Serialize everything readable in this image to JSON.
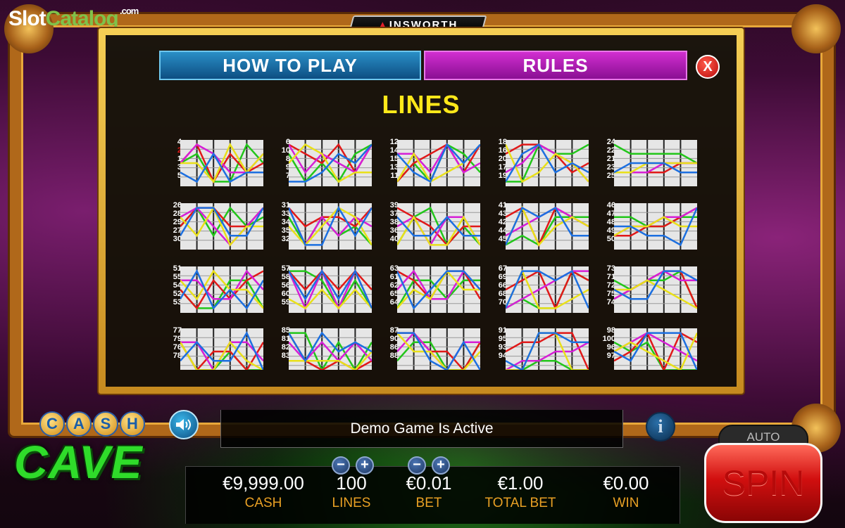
{
  "watermark": {
    "slot": "Slot",
    "catalog": "Catalog",
    "com": ".com"
  },
  "provider": {
    "name": "INSWORTH",
    "triangle": "▲"
  },
  "tabs": {
    "how_to_play": "HOW TO PLAY",
    "rules": "RULES"
  },
  "close_label": "X",
  "lines_title": "LINES",
  "paylines": [
    {
      "nums": [
        "4",
        "2",
        "1",
        "3",
        "5"
      ]
    },
    {
      "nums": [
        "6",
        "10",
        "8",
        "9",
        "7"
      ]
    },
    {
      "nums": [
        "12",
        "14",
        "15",
        "13",
        "11"
      ]
    },
    {
      "nums": [
        "18",
        "16",
        "20",
        "17",
        "19"
      ]
    },
    {
      "nums": [
        "24",
        "22",
        "21",
        "23",
        "25"
      ]
    },
    {
      "nums": [
        "26",
        "28",
        "29",
        "27",
        "30"
      ]
    },
    {
      "nums": [
        "31",
        "33",
        "34",
        "35",
        "32"
      ]
    },
    {
      "nums": [
        "39",
        "37",
        "38",
        "36",
        "40"
      ]
    },
    {
      "nums": [
        "41",
        "43",
        "42",
        "44",
        "45"
      ]
    },
    {
      "nums": [
        "46",
        "47",
        "48",
        "49",
        "50"
      ]
    },
    {
      "nums": [
        "51",
        "55",
        "54",
        "52",
        "53"
      ]
    },
    {
      "nums": [
        "57",
        "58",
        "56",
        "60",
        "59"
      ]
    },
    {
      "nums": [
        "63",
        "61",
        "62",
        "65",
        "64"
      ]
    },
    {
      "nums": [
        "67",
        "69",
        "66",
        "68",
        "70"
      ]
    },
    {
      "nums": [
        "73",
        "71",
        "72",
        "75",
        "74"
      ]
    },
    {
      "nums": [
        "77",
        "79",
        "76",
        "78"
      ]
    },
    {
      "nums": [
        "85",
        "81",
        "82",
        "83"
      ]
    },
    {
      "nums": [
        "87",
        "90",
        "86",
        "88"
      ]
    },
    {
      "nums": [
        "91",
        "95",
        "93",
        "94"
      ]
    },
    {
      "nums": [
        "98",
        "100",
        "96",
        "97"
      ]
    }
  ],
  "line_colors": [
    "#22c61a",
    "#e01919",
    "#d61fd6",
    "#e9e01a",
    "#1c6fe0"
  ],
  "message": "Demo Game Is Active",
  "info_label": "i",
  "game_logo": {
    "cash": [
      "C",
      "A",
      "S",
      "H"
    ],
    "cave": "CAVE"
  },
  "stats": {
    "cash": {
      "value": "€9,999.00",
      "label": "CASH"
    },
    "lines": {
      "value": "100",
      "label": "LINES"
    },
    "bet": {
      "value": "€0.01",
      "label": "BET"
    },
    "total_bet": {
      "value": "€1.00",
      "label": "TOTAL BET"
    },
    "win": {
      "value": "€0.00",
      "label": "WIN"
    }
  },
  "stepper": {
    "minus": "−",
    "plus": "+"
  },
  "spin": {
    "auto": "AUTO",
    "label": "SPIN"
  }
}
